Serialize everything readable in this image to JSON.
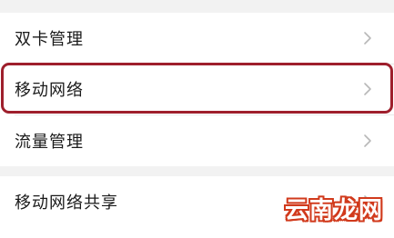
{
  "settings": {
    "items": [
      {
        "label": "双卡管理",
        "icon": "chevron-right-icon"
      },
      {
        "label": "移动网络",
        "icon": "chevron-right-icon",
        "highlighted": true
      },
      {
        "label": "流量管理",
        "icon": "chevron-right-icon"
      },
      {
        "label": "移动网络共享",
        "icon": "chevron-right-icon"
      }
    ]
  },
  "colors": {
    "highlight_border": "#9e1f2c",
    "chevron": "#b8b8b8",
    "watermark_outline": "#d13a1c"
  },
  "watermark": {
    "text": "云南龙网"
  }
}
